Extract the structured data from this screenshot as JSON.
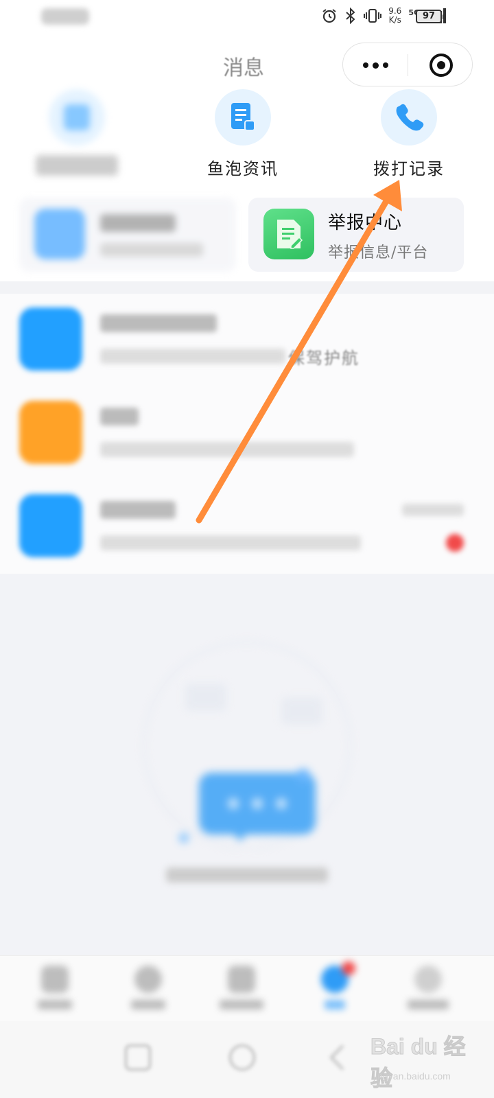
{
  "status_bar": {
    "net_speed_value": "9.6",
    "net_speed_unit": "K/s",
    "network": "5G",
    "battery": "97",
    "icons": [
      "alarm-icon",
      "bluetooth-icon",
      "vibrate-icon",
      "signal-icon",
      "battery-icon"
    ]
  },
  "header": {
    "title": "消息",
    "more_icon": "more-dots-icon",
    "close_icon": "target-circle-icon"
  },
  "quick_actions": [
    {
      "label": "",
      "icon": "blurred-icon",
      "color": "#60b6ff"
    },
    {
      "label": "鱼泡资讯",
      "icon": "document-icon",
      "color": "#2f9cf6"
    },
    {
      "label": "拨打记录",
      "icon": "phone-icon",
      "color": "#2f9cf6"
    }
  ],
  "cards": [
    {
      "title": "",
      "subtitle": "",
      "icon": "blurred-icon",
      "color": "#4aa8ff"
    },
    {
      "title": "举报中心",
      "subtitle": "举报信息/平台",
      "icon": "report-document-icon",
      "color": "#3ecf6d"
    }
  ],
  "messages": [
    {
      "title": "",
      "preview": "保驾护航",
      "time": "",
      "icon": "smile-icon",
      "color": "#22a0ff",
      "badge": false
    },
    {
      "title": "",
      "preview": "",
      "time": "",
      "icon": "gift-icon",
      "color": "#ffa227",
      "badge": false
    },
    {
      "title": "",
      "preview": "",
      "time": "",
      "icon": "message-icon",
      "color": "#22a0ff",
      "badge": true
    }
  ],
  "empty_state": {
    "text": "",
    "illustration": "chat-bubble-illustration"
  },
  "tabbar": [
    {
      "label": "",
      "icon": "home-icon"
    },
    {
      "label": "",
      "icon": "tab-icon-2"
    },
    {
      "label": "",
      "icon": "tab-icon-3"
    },
    {
      "label": "",
      "icon": "message-tab-icon",
      "active": true,
      "badge": true
    },
    {
      "label": "",
      "icon": "profile-icon"
    }
  ],
  "watermark": {
    "logo": "Bai du 经验",
    "url": "jingyan.baidu.com"
  },
  "colors": {
    "arrow": "#ff8c3a",
    "accent_blue": "#22a0ff",
    "badge_red": "#f14a4a"
  }
}
